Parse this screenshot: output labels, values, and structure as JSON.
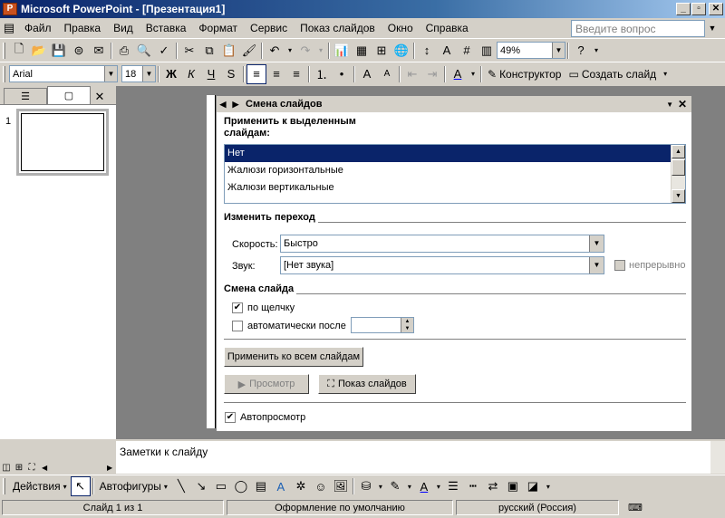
{
  "title": "Microsoft PowerPoint - [Презентация1]",
  "window_controls": [
    "_",
    "▫",
    "✕"
  ],
  "menu": [
    "Файл",
    "Правка",
    "Вид",
    "Вставка",
    "Формат",
    "Сервис",
    "Показ слайдов",
    "Окно",
    "Справка"
  ],
  "help_placeholder": "Введите вопрос",
  "toolbar": {
    "zoom": "49%",
    "font": "Arial",
    "font_size": "18",
    "designer": "Конструктор",
    "new_slide": "Создать слайд"
  },
  "slides_pane": {
    "slide_number": "1"
  },
  "task_pane": {
    "title": "Смена слайдов",
    "apply_label": "Применить к выделенным слайдам:",
    "transitions": [
      "Нет",
      "Жалюзи горизонтальные",
      "Жалюзи вертикальные"
    ],
    "selected_transition": "Нет",
    "modify_title": "Изменить переход",
    "speed_label": "Скорость:",
    "speed_value": "Быстро",
    "sound_label": "Звук:",
    "sound_value": "[Нет звука]",
    "loop_label": "непрерывно",
    "advance_title": "Смена слайда",
    "on_click_label": "по щелчку",
    "on_click_checked": true,
    "auto_label": "автоматически после",
    "auto_checked": false,
    "apply_all": "Применить ко всем слайдам",
    "preview": "Просмотр",
    "slideshow": "Показ слайдов",
    "autopreview_label": "Автопросмотр",
    "autopreview_checked": true
  },
  "notes_placeholder": "Заметки к слайду",
  "drawing": {
    "actions": "Действия",
    "autoshapes": "Автофигуры"
  },
  "status": {
    "slide": "Слайд 1 из 1",
    "design": "Оформление по умолчанию",
    "language": "русский (Россия)"
  }
}
